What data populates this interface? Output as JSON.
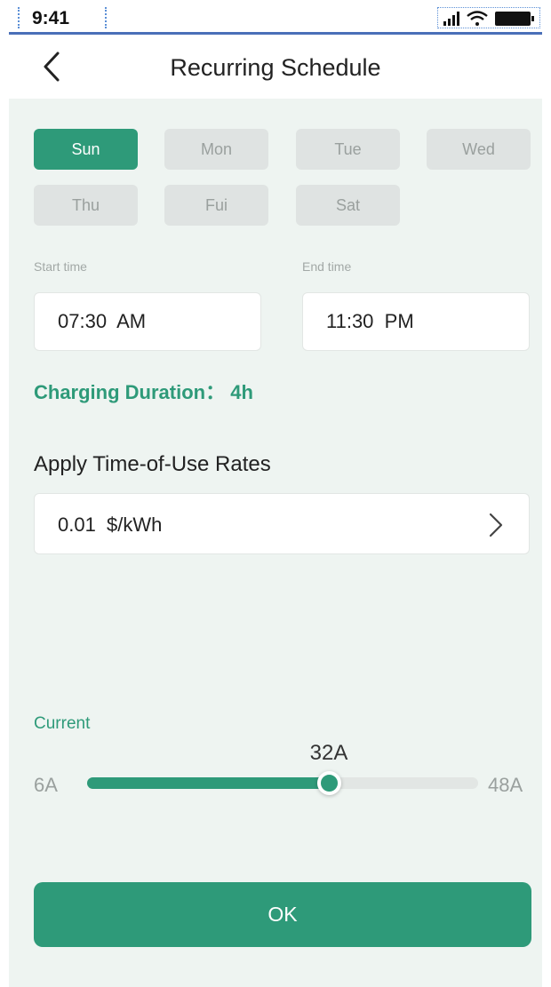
{
  "status_bar": {
    "time": "9:41",
    "icons": [
      "signal-icon",
      "wifi-icon",
      "battery-icon"
    ]
  },
  "header": {
    "title": "Recurring Schedule",
    "back_icon": "chevron-left-icon"
  },
  "days": [
    {
      "label": "Sun",
      "selected": true
    },
    {
      "label": "Mon",
      "selected": false
    },
    {
      "label": "Tue",
      "selected": false
    },
    {
      "label": "Wed",
      "selected": false
    },
    {
      "label": "Thu",
      "selected": false
    },
    {
      "label": "Fui",
      "selected": false
    },
    {
      "label": "Sat",
      "selected": false
    }
  ],
  "start_time": {
    "label": "Start time",
    "value": "07:30  AM"
  },
  "end_time": {
    "label": "End time",
    "value": "11:30  PM"
  },
  "charging_duration": "Charging Duration： 4h",
  "rates": {
    "title": "Apply Time-of-Use Rates",
    "value": "0.01  $/kWh",
    "chevron_icon": "chevron-right-icon"
  },
  "current": {
    "label": "Current",
    "min_label": "6A",
    "max_label": "48A",
    "value_label": "32A",
    "min": 6,
    "max": 48,
    "value": 32
  },
  "ok_label": "OK",
  "colors": {
    "accent": "#2e9a79",
    "background": "#eef4f1",
    "inactive_day": "#dfe3e2"
  }
}
